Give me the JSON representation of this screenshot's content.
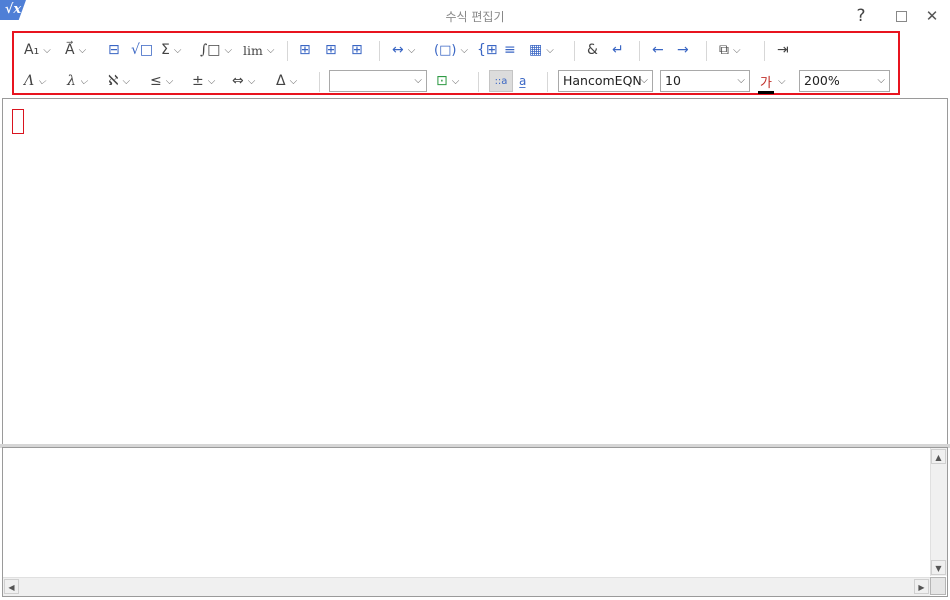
{
  "window": {
    "title": "수식 편집기",
    "app_icon": "√x",
    "help_label": "?",
    "close_label": "✕"
  },
  "toolbar": {
    "row1": {
      "super_sub": "A₁",
      "decoration": "A⃗",
      "fraction": "⊟",
      "root": "√□",
      "sum": "Σ",
      "integral": "∫□",
      "limit": "lim",
      "align_left": "⊞",
      "align_center": "⊞",
      "align_right": "⊞",
      "space": "↔",
      "paren": "(□)",
      "matrix_col": "{⊞",
      "matrix_row": "≡",
      "matrix": "▦",
      "ampersand": "&",
      "newline": "↵",
      "prev": "←",
      "next": "→",
      "convert": "⧉",
      "insert": "⇥"
    },
    "row2": {
      "greek_upper": "Λ",
      "greek_lower": "λ",
      "hebrew": "ℵ",
      "relation": "≤",
      "operator": "±",
      "arrow": "⇔",
      "misc": "Δ",
      "style_select": "",
      "color_picker": "⊡",
      "view_mode_a": "::a",
      "view_mode_b": "a̲",
      "font": "HancomEQN",
      "size": "10",
      "text_color_glyph": "가",
      "zoom": "200%"
    }
  },
  "colors": {
    "highlight_border": "#e8141f",
    "accent_blue": "#3a66c4",
    "text_color_bar": "#000000"
  }
}
